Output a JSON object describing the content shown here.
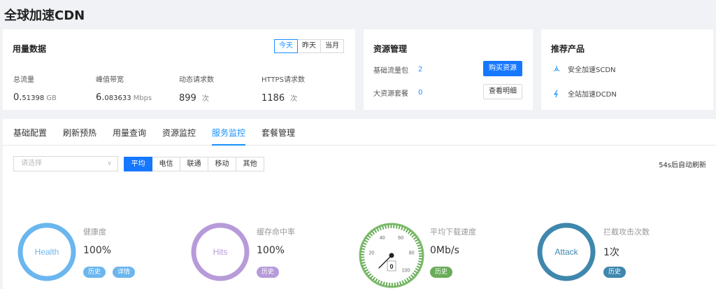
{
  "page": {
    "title": "全球加速CDN"
  },
  "usage": {
    "title": "用量数据",
    "ranges": [
      "今天",
      "昨天",
      "当月"
    ],
    "stats": [
      {
        "label": "总流量",
        "lead": "0.",
        "small": "51398",
        "unit": "GB"
      },
      {
        "label": "峰值带宽",
        "lead": "6.",
        "small": "083633",
        "unit": "Mbps"
      },
      {
        "label": "动态请求数",
        "lead": "899",
        "small": "",
        "unit": "次"
      },
      {
        "label": "HTTPS请求数",
        "lead": "1186",
        "small": "",
        "unit": "次"
      }
    ]
  },
  "resources": {
    "title": "资源管理",
    "basic_label": "基础流量包",
    "basic_count": "2",
    "big_label": "大资源套餐",
    "big_count": "0",
    "buy_label": "购买资源",
    "detail_label": "查看明细"
  },
  "recommend": {
    "title": "推荐产品",
    "items": [
      {
        "label": "安全加速SCDN",
        "icon": "shield-network-icon"
      },
      {
        "label": "全站加速DCDN",
        "icon": "lightning-icon"
      }
    ]
  },
  "tabs": [
    "基础配置",
    "刷新预热",
    "用量查询",
    "资源监控",
    "服务监控",
    "套餐管理"
  ],
  "active_tab": 4,
  "monitor": {
    "select_placeholder": "请选择",
    "isps": [
      "平均",
      "电信",
      "联通",
      "移动",
      "其他"
    ],
    "refresh_text": "54s后自动刷新",
    "health": {
      "ring_text": "Health",
      "label": "健康度",
      "value": "100%",
      "buttons": [
        "历史",
        "详情"
      ],
      "color": "#6bb6ee"
    },
    "hits": {
      "ring_text": "Hits",
      "label": "缓存命中率",
      "value": "100%",
      "buttons": [
        "历史"
      ],
      "color": "#b79bd9"
    },
    "speed": {
      "label": "平均下载速度",
      "value": "0Mb/s",
      "buttons": [
        "历史"
      ],
      "color": "#6aac5a",
      "gauge_ticks": [
        "20",
        "40",
        "60",
        "80",
        "100"
      ],
      "gauge_reading": "0",
      "gauge_value": 0
    },
    "attack": {
      "ring_text": "Attack",
      "label": "拦截攻击次数",
      "value": "1次",
      "buttons": [
        "历史"
      ],
      "color": "#3f87ad"
    }
  }
}
